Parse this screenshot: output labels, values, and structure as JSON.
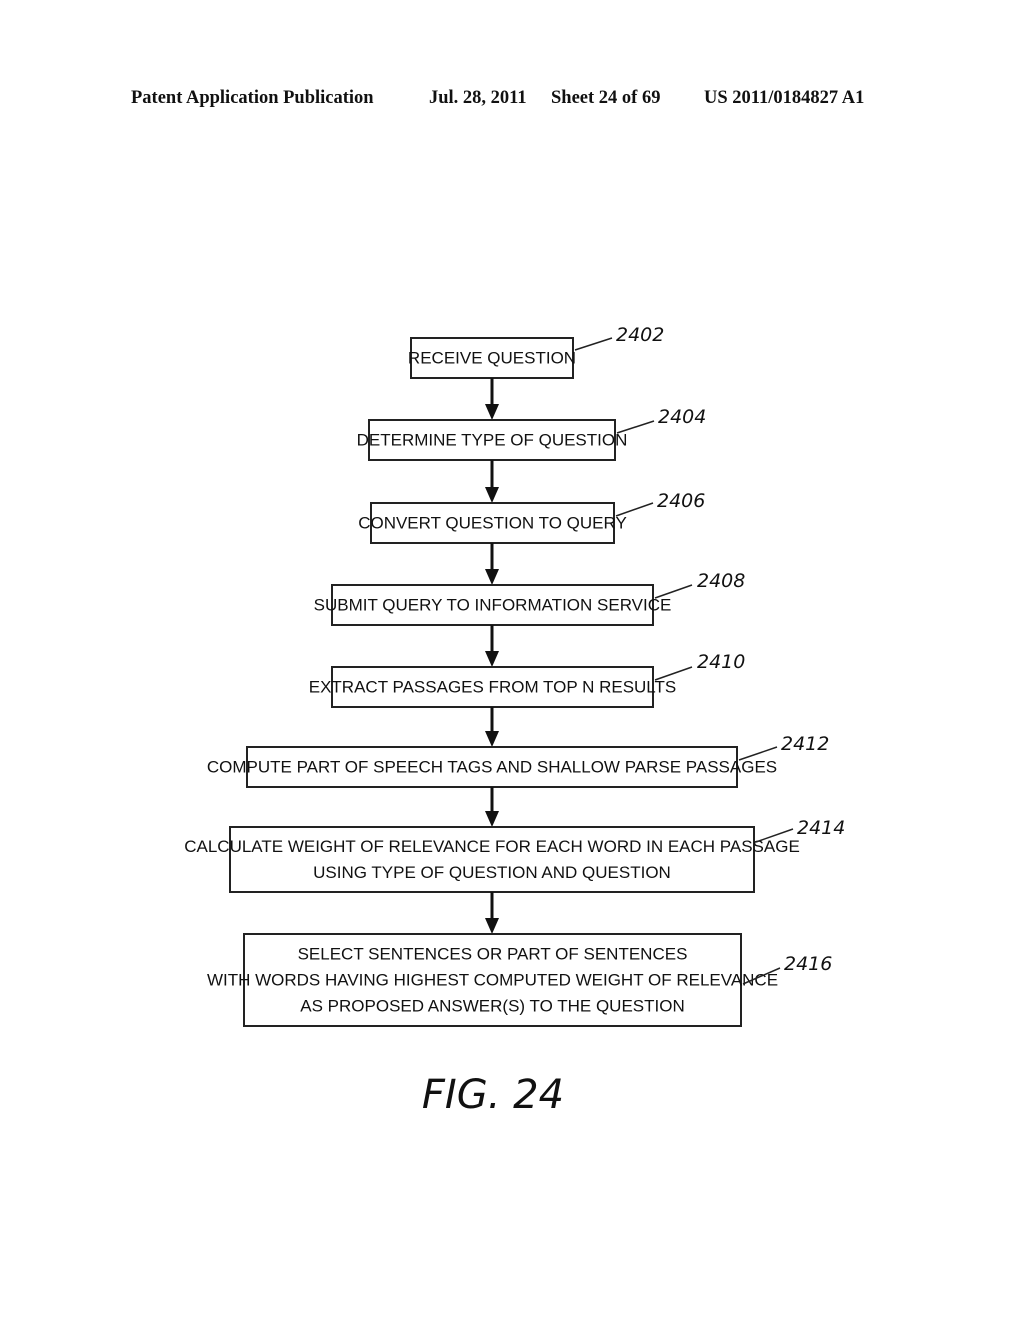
{
  "header": {
    "publication": "Patent Application Publication",
    "date": "Jul. 28, 2011",
    "sheet": "Sheet 24 of 69",
    "number": "US 2011/0184827 A1"
  },
  "figure_label": "FIG. 24",
  "steps": [
    {
      "ref": "2402",
      "lines": [
        "RECEIVE QUESTION"
      ]
    },
    {
      "ref": "2404",
      "lines": [
        "DETERMINE TYPE OF QUESTION"
      ]
    },
    {
      "ref": "2406",
      "lines": [
        "CONVERT QUESTION TO QUERY"
      ]
    },
    {
      "ref": "2408",
      "lines": [
        "SUBMIT QUERY TO INFORMATION SERVICE"
      ]
    },
    {
      "ref": "2410",
      "lines": [
        "EXTRACT PASSAGES FROM TOP N RESULTS"
      ]
    },
    {
      "ref": "2412",
      "lines": [
        "COMPUTE PART OF SPEECH TAGS AND SHALLOW PARSE PASSAGES"
      ]
    },
    {
      "ref": "2414",
      "lines": [
        "CALCULATE WEIGHT OF RELEVANCE FOR EACH WORD IN EACH PASSAGE",
        "USING TYPE OF QUESTION AND QUESTION"
      ]
    },
    {
      "ref": "2416",
      "lines": [
        "SELECT SENTENCES OR PART OF SENTENCES",
        "WITH WORDS HAVING HIGHEST COMPUTED WEIGHT OF RELEVANCE",
        "AS PROPOSED ANSWER(S) TO THE QUESTION"
      ]
    }
  ]
}
